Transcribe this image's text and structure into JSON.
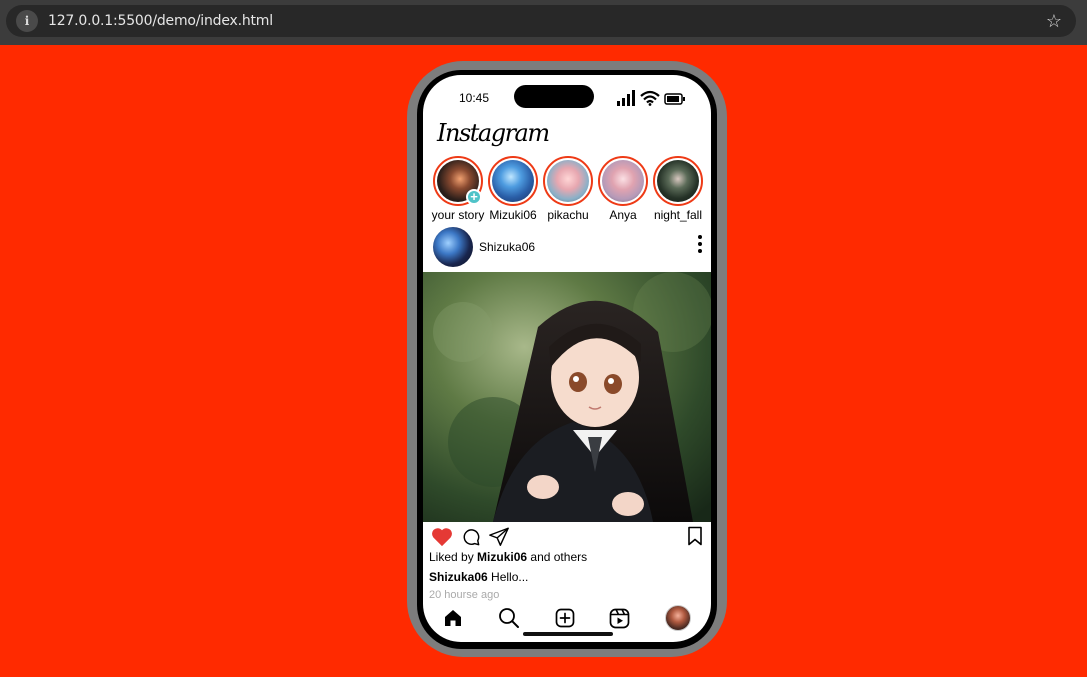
{
  "browser": {
    "url": "127.0.0.1:5500/demo/index.html"
  },
  "status_bar": {
    "time": "10:45"
  },
  "app": {
    "logo": "Instagram"
  },
  "stories": [
    {
      "label": "your story",
      "has_add": true
    },
    {
      "label": "Mizuki06"
    },
    {
      "label": "pikachu"
    },
    {
      "label": "Anya"
    },
    {
      "label": "night_fall"
    }
  ],
  "post": {
    "username": "Shizuka06",
    "likes_prefix": "Liked by",
    "liked_by": "Mizuki06",
    "likes_suffix": "and others",
    "caption_user": "Shizuka06",
    "caption_text": "Hello...",
    "time_ago": "20 hourse ago",
    "liked": true
  },
  "colors": {
    "page_background": "#ff2a00",
    "story_ring": "#ee3a16",
    "heart": "#e53935",
    "add_badge": "#4fc3c8"
  },
  "icons": {
    "nav": [
      "home-icon",
      "search-icon",
      "create-post-icon",
      "reels-icon",
      "profile-avatar"
    ]
  }
}
